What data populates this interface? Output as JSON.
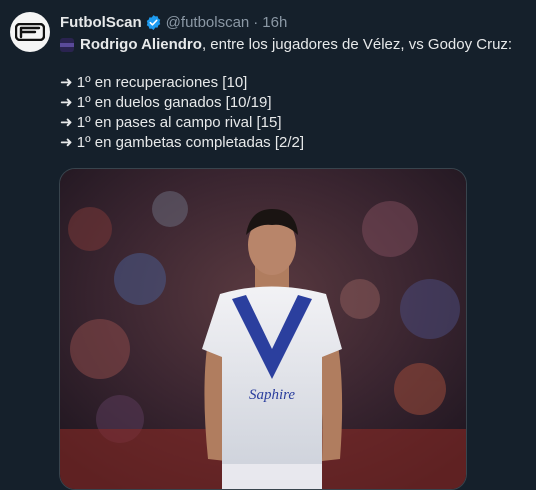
{
  "account": {
    "display_name": "FutbolScan",
    "handle": "@futbolscan",
    "separator": "·",
    "timestamp": "16h",
    "avatar_text": "FS",
    "verified_color": "#1d9bf0"
  },
  "tweet": {
    "intro_name": "Rodrigo Aliendro",
    "intro_rest": ", entre los jugadores de Vélez, vs Godoy Cruz:",
    "stats": [
      "➜ 1º en recuperaciones [10]",
      "➜ 1º en duelos ganados [10/19]",
      "➜ 1º en pases al campo rival [15]",
      "➜ 1º en gambetas completadas [2/2]"
    ]
  },
  "media": {
    "jersey_text": "Saphire"
  },
  "colors": {
    "background": "#15202b",
    "text": "#e7e9ea",
    "secondary_text": "#8b98a5",
    "jersey_blue": "#2b3f9e"
  }
}
